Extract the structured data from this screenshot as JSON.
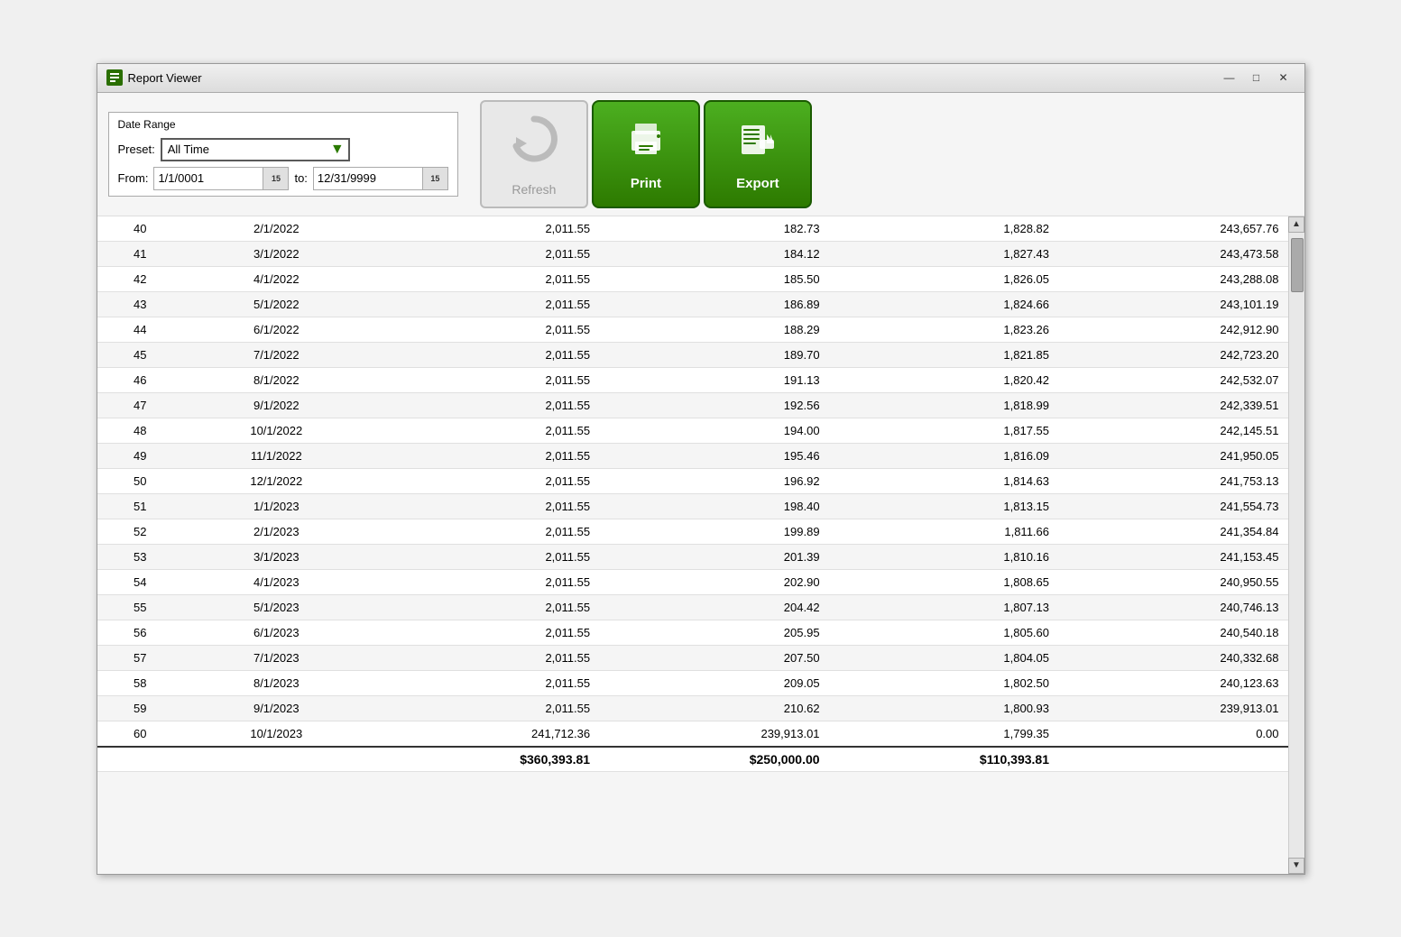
{
  "window": {
    "title": "Report Viewer",
    "app_icon": "RV"
  },
  "toolbar": {
    "date_range_label": "Date Range",
    "preset_label": "Preset:",
    "preset_value": "All Time",
    "from_label": "From:",
    "from_value": "1/1/0001",
    "to_label": "to:",
    "to_value": "12/31/9999",
    "cal_num": "15",
    "refresh_label": "Refresh",
    "print_label": "Print",
    "export_label": "Export"
  },
  "win_controls": {
    "minimize": "—",
    "maximize": "□",
    "close": "✕"
  },
  "table": {
    "rows": [
      {
        "num": "40",
        "date": "2/1/2022",
        "payment": "2,011.55",
        "interest": "182.73",
        "principal": "1,828.82",
        "balance": "243,657.76"
      },
      {
        "num": "41",
        "date": "3/1/2022",
        "payment": "2,011.55",
        "interest": "184.12",
        "principal": "1,827.43",
        "balance": "243,473.58"
      },
      {
        "num": "42",
        "date": "4/1/2022",
        "payment": "2,011.55",
        "interest": "185.50",
        "principal": "1,826.05",
        "balance": "243,288.08"
      },
      {
        "num": "43",
        "date": "5/1/2022",
        "payment": "2,011.55",
        "interest": "186.89",
        "principal": "1,824.66",
        "balance": "243,101.19"
      },
      {
        "num": "44",
        "date": "6/1/2022",
        "payment": "2,011.55",
        "interest": "188.29",
        "principal": "1,823.26",
        "balance": "242,912.90"
      },
      {
        "num": "45",
        "date": "7/1/2022",
        "payment": "2,011.55",
        "interest": "189.70",
        "principal": "1,821.85",
        "balance": "242,723.20"
      },
      {
        "num": "46",
        "date": "8/1/2022",
        "payment": "2,011.55",
        "interest": "191.13",
        "principal": "1,820.42",
        "balance": "242,532.07"
      },
      {
        "num": "47",
        "date": "9/1/2022",
        "payment": "2,011.55",
        "interest": "192.56",
        "principal": "1,818.99",
        "balance": "242,339.51"
      },
      {
        "num": "48",
        "date": "10/1/2022",
        "payment": "2,011.55",
        "interest": "194.00",
        "principal": "1,817.55",
        "balance": "242,145.51"
      },
      {
        "num": "49",
        "date": "11/1/2022",
        "payment": "2,011.55",
        "interest": "195.46",
        "principal": "1,816.09",
        "balance": "241,950.05"
      },
      {
        "num": "50",
        "date": "12/1/2022",
        "payment": "2,011.55",
        "interest": "196.92",
        "principal": "1,814.63",
        "balance": "241,753.13"
      },
      {
        "num": "51",
        "date": "1/1/2023",
        "payment": "2,011.55",
        "interest": "198.40",
        "principal": "1,813.15",
        "balance": "241,554.73"
      },
      {
        "num": "52",
        "date": "2/1/2023",
        "payment": "2,011.55",
        "interest": "199.89",
        "principal": "1,811.66",
        "balance": "241,354.84"
      },
      {
        "num": "53",
        "date": "3/1/2023",
        "payment": "2,011.55",
        "interest": "201.39",
        "principal": "1,810.16",
        "balance": "241,153.45"
      },
      {
        "num": "54",
        "date": "4/1/2023",
        "payment": "2,011.55",
        "interest": "202.90",
        "principal": "1,808.65",
        "balance": "240,950.55"
      },
      {
        "num": "55",
        "date": "5/1/2023",
        "payment": "2,011.55",
        "interest": "204.42",
        "principal": "1,807.13",
        "balance": "240,746.13"
      },
      {
        "num": "56",
        "date": "6/1/2023",
        "payment": "2,011.55",
        "interest": "205.95",
        "principal": "1,805.60",
        "balance": "240,540.18"
      },
      {
        "num": "57",
        "date": "7/1/2023",
        "payment": "2,011.55",
        "interest": "207.50",
        "principal": "1,804.05",
        "balance": "240,332.68"
      },
      {
        "num": "58",
        "date": "8/1/2023",
        "payment": "2,011.55",
        "interest": "209.05",
        "principal": "1,802.50",
        "balance": "240,123.63"
      },
      {
        "num": "59",
        "date": "9/1/2023",
        "payment": "2,011.55",
        "interest": "210.62",
        "principal": "1,800.93",
        "balance": "239,913.01"
      },
      {
        "num": "60",
        "date": "10/1/2023",
        "payment": "241,712.36",
        "interest": "239,913.01",
        "principal": "1,799.35",
        "balance": "0.00"
      }
    ],
    "totals": {
      "payment": "$360,393.81",
      "interest": "$250,000.00",
      "principal": "$110,393.81",
      "balance": ""
    }
  }
}
